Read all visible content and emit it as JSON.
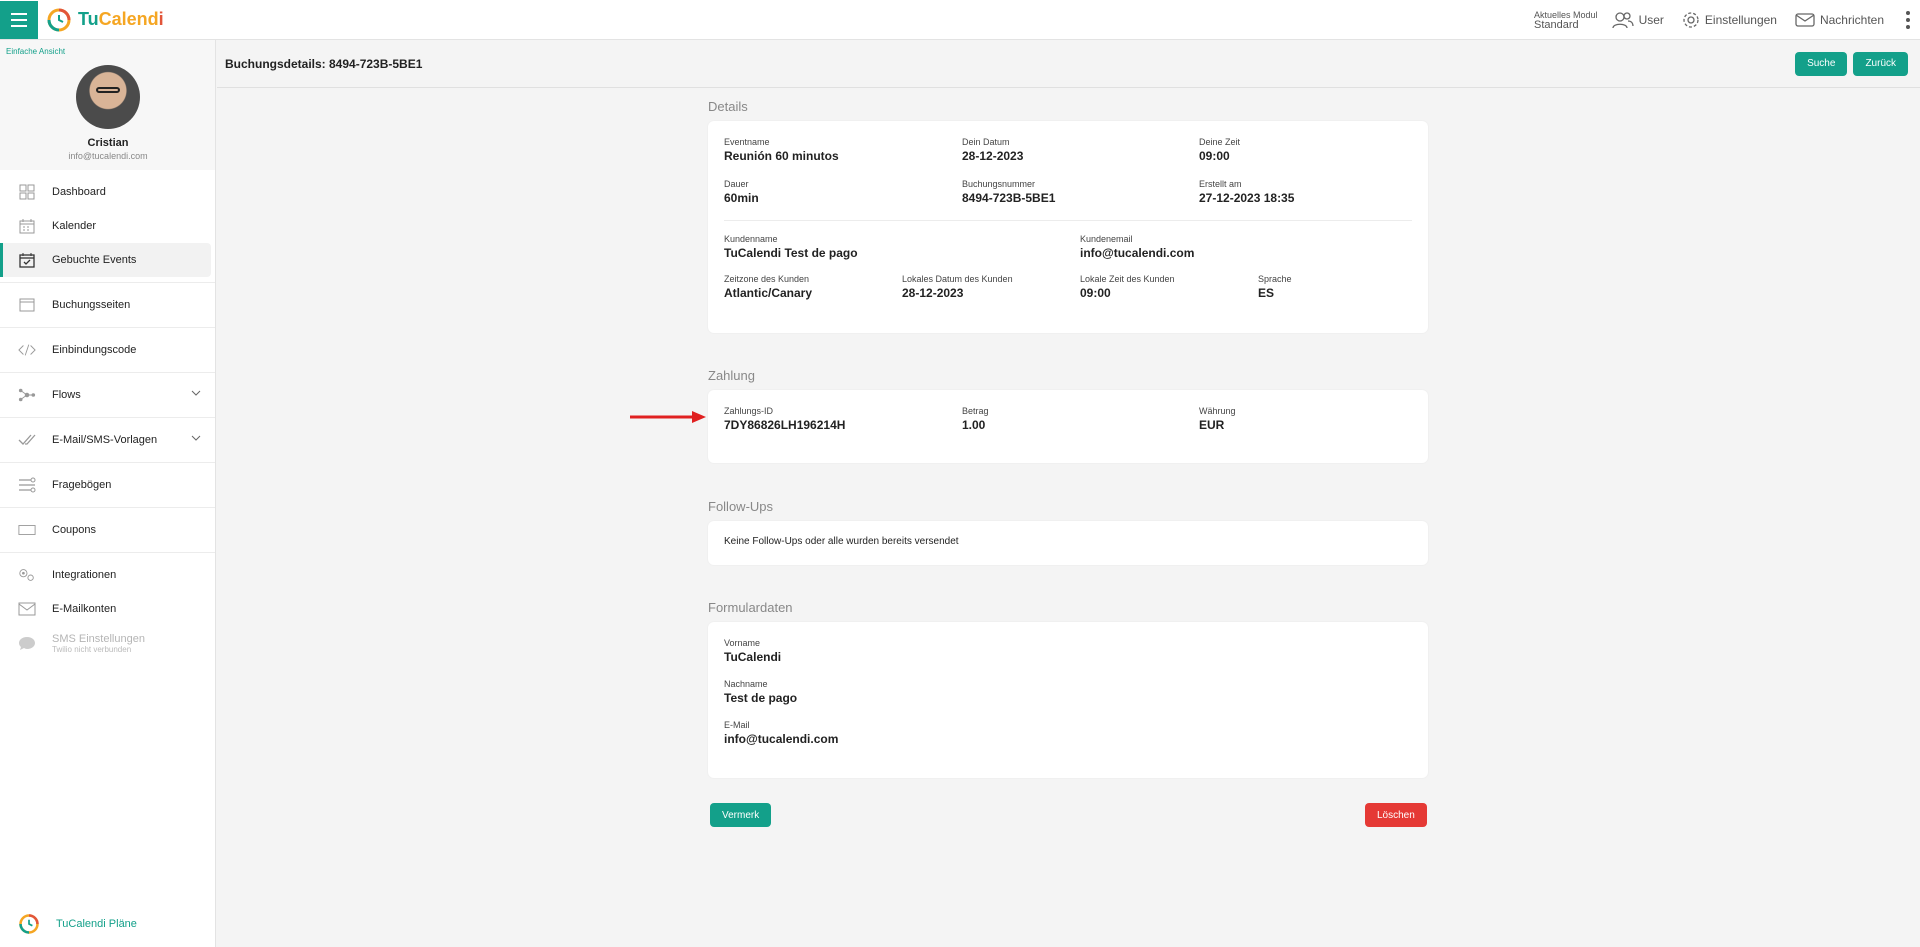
{
  "header": {
    "app_name_tu": "Tu",
    "app_name_cal": "Calend",
    "app_name_i": "i",
    "module_label": "Aktuelles Modul",
    "module_value": "Standard",
    "user_label": "User",
    "settings_label": "Einstellungen",
    "messages_label": "Nachrichten"
  },
  "sidebar": {
    "simple_view": "Einfache Ansicht",
    "profile_name": "Cristian",
    "profile_email": "info@tucalendi.com",
    "items": [
      {
        "label": "Dashboard",
        "icon": "grid-icon"
      },
      {
        "label": "Kalender",
        "icon": "calendar-icon"
      },
      {
        "label": "Gebuchte Events",
        "icon": "calendar-check-icon"
      },
      {
        "label": "Buchungsseiten",
        "icon": "window-icon"
      },
      {
        "label": "Einbindungscode",
        "icon": "code-icon"
      },
      {
        "label": "Flows",
        "icon": "flows-icon"
      },
      {
        "label": "E-Mail/SMS-Vorlagen",
        "icon": "double-check-icon"
      },
      {
        "label": "Fragebögen",
        "icon": "questionnaire-icon"
      },
      {
        "label": "Coupons",
        "icon": "coupon-icon"
      },
      {
        "label": "Integrationen",
        "icon": "integrations-icon"
      },
      {
        "label": "E-Mailkonten",
        "icon": "envelope-icon"
      },
      {
        "label": "SMS Einstellungen",
        "sub": "Twilio nicht verbunden",
        "icon": "sms-icon"
      }
    ],
    "plans_label": "TuCalendi Pläne"
  },
  "page": {
    "title": "Buchungsdetails: 8494-723B-5BE1",
    "search_btn": "Suche",
    "back_btn": "Zurück"
  },
  "details": {
    "section_title": "Details",
    "event_name_label": "Eventname",
    "event_name": "Reunión 60 minutos",
    "date_label": "Dein Datum",
    "date": "28-12-2023",
    "time_label": "Deine Zeit",
    "time": "09:00",
    "duration_label": "Dauer",
    "duration": "60min",
    "booking_no_label": "Buchungsnummer",
    "booking_no": "8494-723B-5BE1",
    "created_label": "Erstellt am",
    "created": "27-12-2023 18:35",
    "customer_name_label": "Kundenname",
    "customer_name": "TuCalendi Test de pago",
    "customer_email_label": "Kundenemail",
    "customer_email": "info@tucalendi.com",
    "tz_label": "Zeitzone des Kunden",
    "tz": "Atlantic/Canary",
    "local_date_label": "Lokales Datum des Kunden",
    "local_date": "28-12-2023",
    "local_time_label": "Lokale Zeit des Kunden",
    "local_time": "09:00",
    "language_label": "Sprache",
    "language": "ES"
  },
  "payment": {
    "section_title": "Zahlung",
    "id_label": "Zahlungs-ID",
    "id": "7DY86826LH196214H",
    "amount_label": "Betrag",
    "amount": "1.00",
    "currency_label": "Währung",
    "currency": "EUR"
  },
  "followups": {
    "section_title": "Follow-Ups",
    "text": "Keine Follow-Ups oder alle wurden bereits versendet"
  },
  "form": {
    "section_title": "Formulardaten",
    "first_name_label": "Vorname",
    "first_name": "TuCalendi",
    "last_name_label": "Nachname",
    "last_name": "Test de pago",
    "email_label": "E-Mail",
    "email": "info@tucalendi.com"
  },
  "actions": {
    "note_btn": "Vermerk",
    "delete_btn": "Löschen"
  },
  "colors": {
    "accent": "#13a08a",
    "danger": "#e53935",
    "arrow": "#e02020"
  }
}
